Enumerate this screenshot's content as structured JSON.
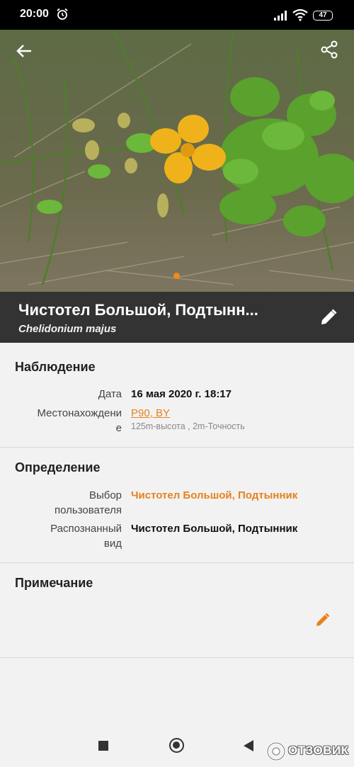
{
  "status_bar": {
    "time": "20:00",
    "battery": "47"
  },
  "header": {
    "title": "Чистотел Большой, Подтынн...",
    "subtitle": "Chelidonium majus"
  },
  "observation": {
    "heading": "Наблюдение",
    "date_label": "Дата",
    "date_value": "16 мая 2020 г.  18:17",
    "location_label_line1": "Местонахождени",
    "location_label_line2": "е",
    "location_value": "P90, BY",
    "location_note": "125m-высота , 2m-Точность"
  },
  "identification": {
    "heading": "Определение",
    "user_choice_label_line1": "Выбор",
    "user_choice_label_line2": "пользователя",
    "user_choice_value": "Чистотел Большой, Подтынник",
    "recognized_label_line1": "Распознанный",
    "recognized_label_line2": "вид",
    "recognized_value": "Чистотел Большой, Подтынник"
  },
  "note": {
    "heading": "Примечание"
  },
  "watermark": {
    "text": "ОТЗОВИК"
  },
  "colors": {
    "accent": "#e8811c",
    "title_bar": "#333333",
    "background": "#f2f2f2"
  },
  "icons": [
    "alarm-icon",
    "signal-icon",
    "wifi-icon",
    "battery-icon",
    "back-arrow-icon",
    "share-icon",
    "pencil-icon",
    "nav-recents-icon",
    "nav-home-icon",
    "nav-back-icon"
  ]
}
